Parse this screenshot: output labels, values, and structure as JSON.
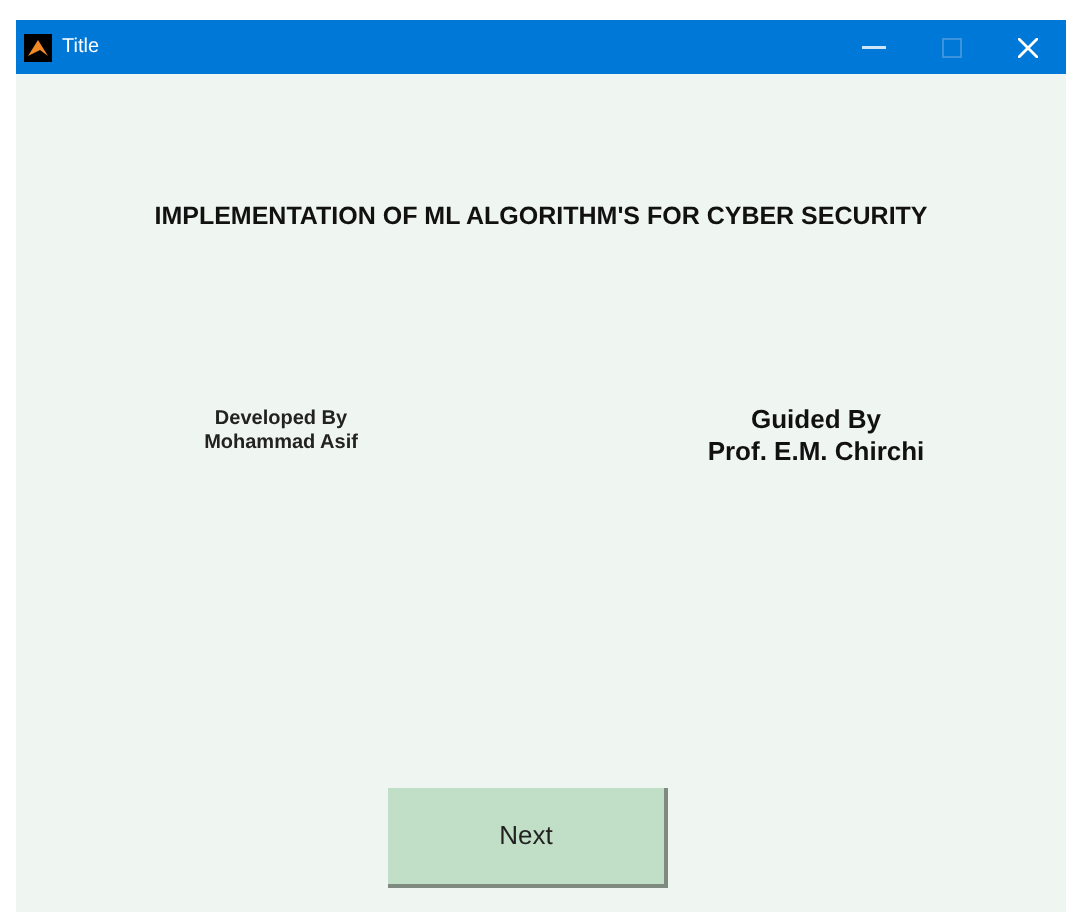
{
  "window": {
    "title": "Title"
  },
  "heading": "IMPLEMENTATION OF ML ALGORITHM'S FOR CYBER SECURITY",
  "developer": {
    "label": "Developed By",
    "name": "Mohammad Asif"
  },
  "guide": {
    "label": "Guided By",
    "name": "Prof. E.M. Chirchi"
  },
  "button": "Next"
}
